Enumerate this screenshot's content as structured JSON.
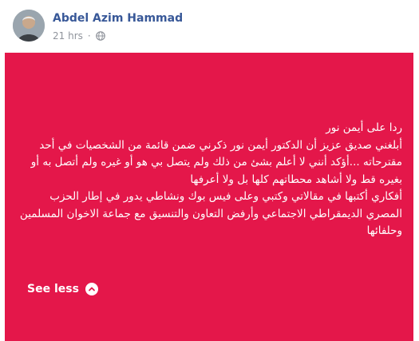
{
  "post": {
    "author": {
      "name": "Abdel Azim Hammad"
    },
    "timestamp": "21 hrs",
    "privacy_icon": "globe-icon",
    "background_color": "#e4174a",
    "paragraphs": [
      "ردا على أيمن نور",
      "أبلغني صديق عزيز أن الدكتور أيمن نور ذكرني ضمن قائمة من الشخصيات في أحد مقترحاته ...أؤكد أنني لا أعلم بشئ من ذلك ولم يتصل بي هو أو غيره ولم أتصل به أو بغيره قط ولا أشاهد محطاتهم كلها بل ولا أعرفها",
      "أفكاري أكتبها في مقالاتي وكتبي وعلى فيس بوك ونشاطي يدور في إطار الحزب المصري الديمقراطي الاجتماعي وأرفض التعاون والتنسيق مع جماعة الاخوان المسلمين وحلفائها"
    ],
    "see_less_label": "See less",
    "see_less_icon": "chevron-up-icon"
  }
}
